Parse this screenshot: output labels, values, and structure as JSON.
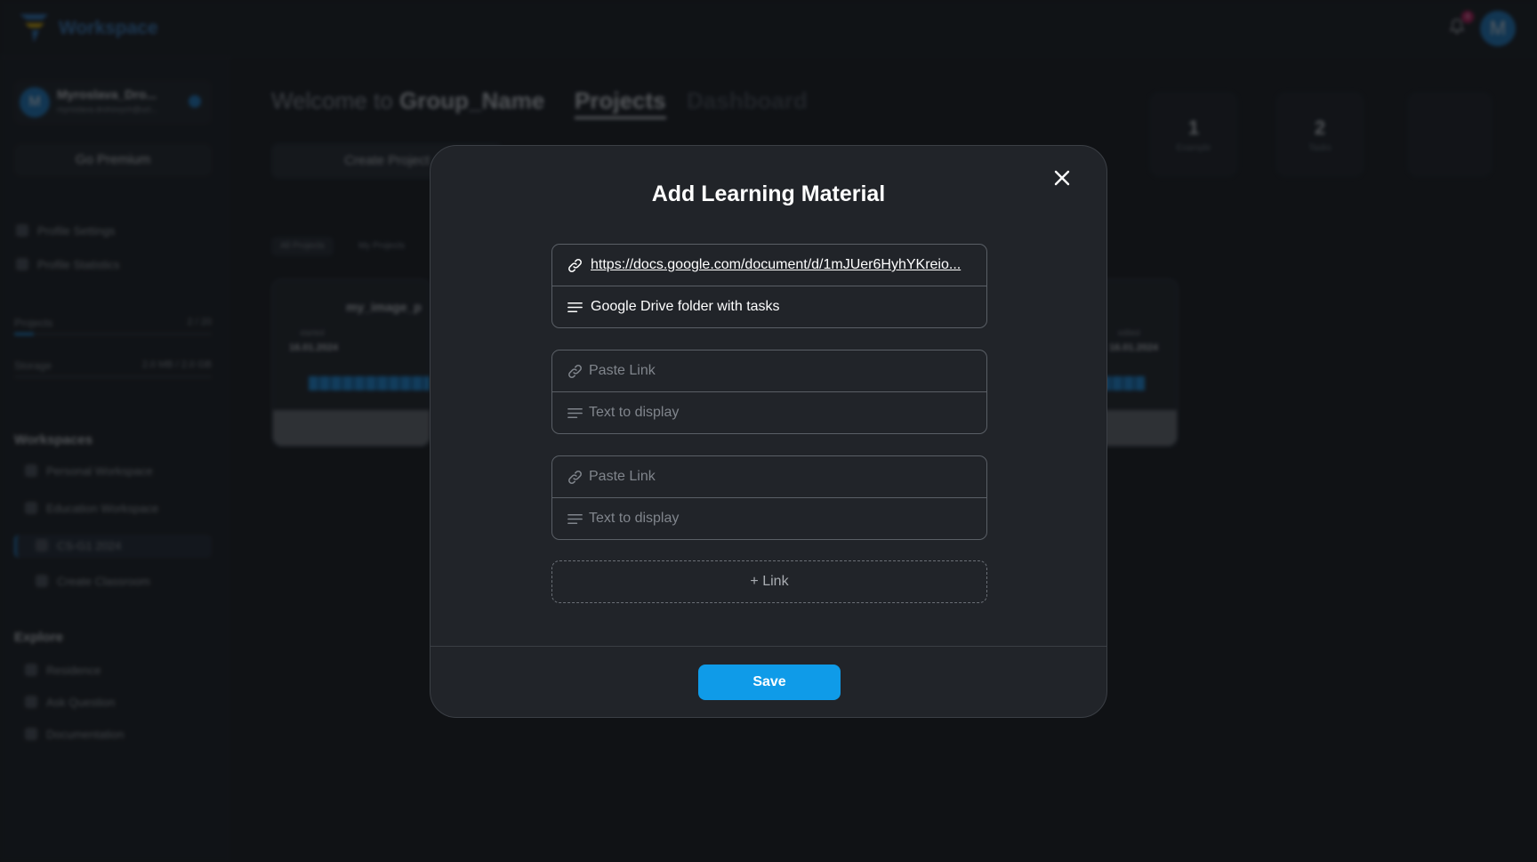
{
  "app": {
    "brand": "Workspace",
    "notification_count": "4",
    "avatar_initial": "M"
  },
  "sidebar": {
    "user_name": "Myroslava_Dro...",
    "user_email": "myroslava.drohovych@ucl...",
    "go_premium": "Go Premium",
    "links": [
      "Profile Settings",
      "Profile Statistics"
    ],
    "projects_label": "Projects",
    "projects_value": "2 / 20",
    "projects_fill": 0.1,
    "storage_label": "Storage",
    "storage_value": "2.0 MB / 2.0 GB",
    "storage_fill": 0.0,
    "workspaces_heading": "Workspaces",
    "workspaces": [
      "Personal Workspace",
      "Education Workspace",
      "CS-G1 2024",
      "Create Classroom"
    ],
    "explore_heading": "Explore",
    "explore": [
      "Residence",
      "Ask Question",
      "Documentation"
    ]
  },
  "main": {
    "welcome_prefix": "Welcome to ",
    "group_name": "Group_Name",
    "tab_projects": "Projects",
    "tab_dashboard": "Dashboard",
    "create_project": "Create Project",
    "filters": [
      "All Projects",
      "My Projects"
    ],
    "stats": [
      {
        "value": "1",
        "label": "Example"
      },
      {
        "value": "2",
        "label": "Tasks"
      }
    ],
    "card_title": "my_image_p",
    "card_started_label": "started",
    "card_started_date": "16.01.2024",
    "card_edited_label": "edited",
    "card_edited_date": "16.01.2024"
  },
  "modal": {
    "title": "Add Learning Material",
    "materials": [
      {
        "url": "https://docs.google.com/document/d/1mJUer6HyhYKreio...",
        "display": "Google Drive folder with tasks"
      }
    ],
    "empty_rows": [
      {
        "link_placeholder": "Paste Link",
        "text_placeholder": "Text to display"
      },
      {
        "link_placeholder": "Paste Link",
        "text_placeholder": "Text to display"
      }
    ],
    "add_link_label": "+ Link",
    "save_label": "Save"
  },
  "colors": {
    "accent": "#0f9be8",
    "modal_bg": "#212429",
    "page_bg": "#14161a"
  },
  "icons": [
    "logo-icon",
    "bell-icon",
    "close-icon",
    "link-icon",
    "text-lines-icon"
  ]
}
